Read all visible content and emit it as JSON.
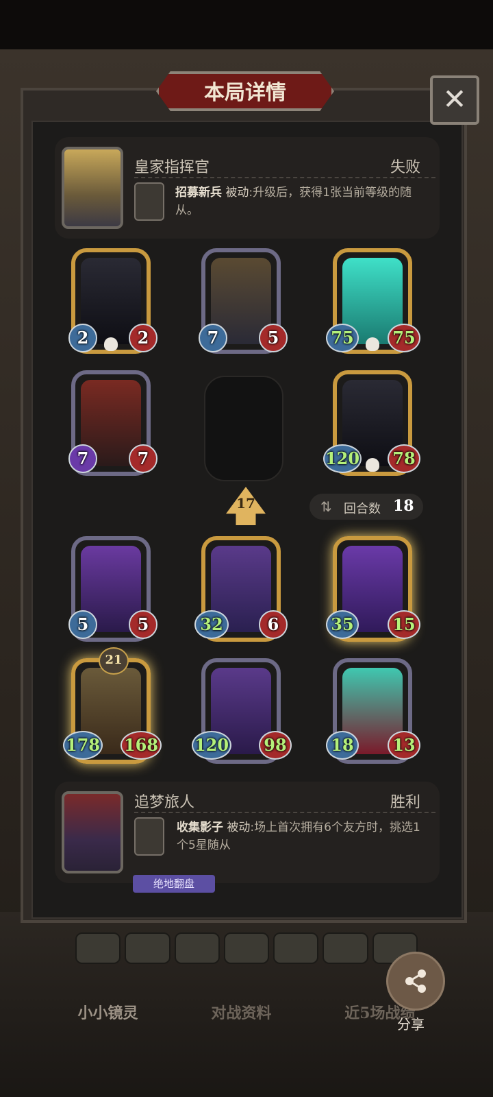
{
  "dialog": {
    "title": "本局详情",
    "close_symbol": "✕"
  },
  "player1": {
    "name": "皇家指挥官",
    "result": "失败",
    "skill_name": "招募新兵",
    "skill_type": "被动",
    "skill_desc": ":升级后，获得1张当前等级的随从。"
  },
  "player1_board": [
    {
      "atk": "2",
      "hp": "2"
    },
    {
      "atk": "7",
      "hp": "5"
    },
    {
      "atk": "75",
      "hp": "75"
    },
    {
      "atk": "7",
      "hp": "7"
    },
    {
      "atk": "120",
      "hp": "78"
    }
  ],
  "rank": {
    "value": "17"
  },
  "rounds": {
    "label": "回合数",
    "value": "18"
  },
  "player2_board": [
    {
      "atk": "5",
      "hp": "5"
    },
    {
      "atk": "32",
      "hp": "6"
    },
    {
      "atk": "35",
      "hp": "15"
    },
    {
      "atk": "178",
      "hp": "168",
      "level": "21"
    },
    {
      "atk": "120",
      "hp": "98"
    },
    {
      "atk": "18",
      "hp": "13"
    }
  ],
  "player2": {
    "name": "追梦旅人",
    "result": "胜利",
    "skill_name": "收集影子",
    "skill_type": "被动",
    "skill_desc": ":场上首次拥有6个友方时，挑选1个5星随从",
    "tag": "绝地翻盘"
  },
  "bottom_tabs": [
    "小小镜灵",
    "对战资料",
    "近5场战绩"
  ],
  "share": {
    "label": "分享"
  },
  "colors": {
    "gold_frame": "#c99a3f",
    "purple_frame": "#6d6a86",
    "title_red": "#6e1a17",
    "green_stat": "#b4f07a"
  }
}
